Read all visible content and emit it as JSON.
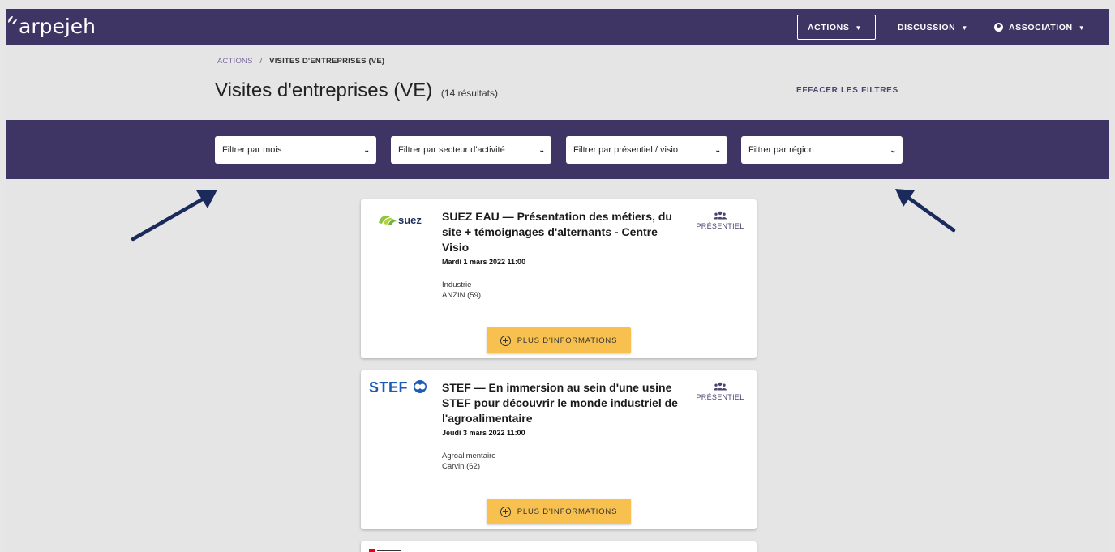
{
  "brand": {
    "name": "arpejeh",
    "accent": "#3f3564",
    "button_color": "#f7c04f"
  },
  "nav": {
    "actions_label": "ACTIONS",
    "discussion_label": "DISCUSSION",
    "association_label": "ASSOCIATION"
  },
  "breadcrumb": {
    "parent": "ACTIONS",
    "separator": "/",
    "current": "VISITES D'ENTREPRISES (VE)"
  },
  "page": {
    "title": "Visites d'entreprises (VE)",
    "count": "(14 résultats)",
    "clear_filters": "EFFACER LES FILTRES"
  },
  "filters": [
    {
      "label": "Filtrer par mois"
    },
    {
      "label": "Filtrer par secteur d'activité"
    },
    {
      "label": "Filtrer par présentiel / visio"
    },
    {
      "label": "Filtrer par région"
    }
  ],
  "cards": [
    {
      "logo": "SUEZ",
      "logo_text": "suez",
      "title": "SUEZ EAU  — Présentation des métiers, du site + témoignages d'alternants - Centre Visio",
      "date": "Mardi 1 mars 2022 11:00",
      "sector": "Industrie",
      "location": "ANZIN (59)",
      "mode": "PRÉSENTIEL",
      "button": "PLUS D'INFORMATIONS"
    },
    {
      "logo": "STEF",
      "logo_text": "STEF",
      "title": "STEF  — En immersion au sein d'une usine STEF pour découvrir le monde industriel de l'agroalimentaire",
      "date": "Jeudi 3 mars 2022 11:00",
      "sector": "Agroalimentaire",
      "location": "Carvin (62)",
      "mode": "PRÉSENTIEL",
      "button": "PLUS D'INFORMATIONS"
    }
  ]
}
